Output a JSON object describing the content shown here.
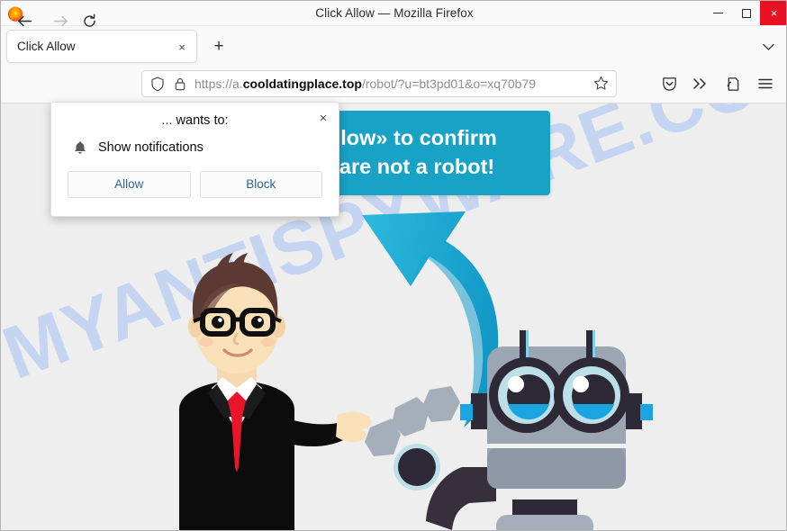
{
  "window": {
    "title": "Click Allow — Mozilla Firefox",
    "minimize_label": "Minimize",
    "maximize_label": "Maximize",
    "close_label": "Close",
    "close_glyph": "×"
  },
  "tabs": {
    "items": [
      {
        "label": "Click Allow",
        "close_glyph": "×"
      }
    ],
    "new_tab_glyph": "+",
    "list_all_tabs_glyph": "⌄"
  },
  "nav": {
    "back_glyph": "←",
    "forward_glyph": "→",
    "reload_glyph": "↻"
  },
  "urlbar": {
    "scheme": "https://",
    "subdomain": "a.",
    "domain": "cooldatingplace.top",
    "path": "/robot/?u=bt3pd01&o=xq70b79",
    "full_url": "https://a.cooldatingplace.top/robot/?u=bt3pd01&o=xq70b79",
    "shield_icon": "tracking-protection-shield-icon",
    "lock_icon": "padlock-icon",
    "bookmark_icon": "star-icon"
  },
  "toolbar": {
    "pocket_icon": "save-to-pocket-icon",
    "overflow_glyph": "»",
    "account_icon": "account-icon",
    "menu_icon": "hamburger-menu-icon"
  },
  "page": {
    "background_color": "#eeeeee",
    "watermark": "MYANTISPYWARE.COM",
    "watermark_color": "#c3d4f2",
    "banner": {
      "line1": "Click «Allow» to confirm",
      "line2": "that you are not a robot!",
      "background_color": "#17a2c6",
      "text_color": "#ffffff"
    },
    "arrow": {
      "name": "curved-blue-arrow",
      "color": "#17a2c6"
    },
    "illustration": {
      "man": "businessman-pointing",
      "robot": "grey-robot"
    }
  },
  "notification_dialog": {
    "title": "... wants to:",
    "permission_icon": "bell-icon",
    "permission_label": "Show notifications",
    "allow_label": "Allow",
    "block_label": "Block",
    "close_glyph": "×",
    "button_text_color": "#2a6496"
  }
}
